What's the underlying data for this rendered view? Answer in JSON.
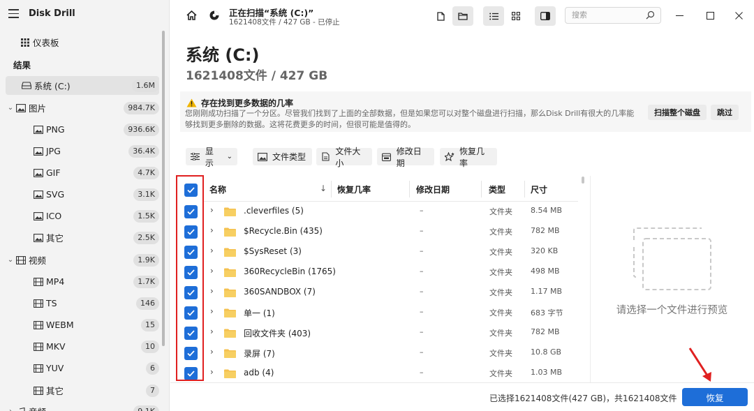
{
  "app": {
    "name": "Disk Drill"
  },
  "sidebar": {
    "dashboard": "仪表板",
    "section_results": "结果",
    "items": [
      {
        "label": "系统 (C:)",
        "count": "1.6M",
        "type": "drive"
      },
      {
        "label": "图片",
        "count": "984.7K",
        "type": "image-group"
      },
      {
        "label": "PNG",
        "count": "936.6K",
        "type": "image"
      },
      {
        "label": "JPG",
        "count": "36.4K",
        "type": "image"
      },
      {
        "label": "GIF",
        "count": "4.7K",
        "type": "image"
      },
      {
        "label": "SVG",
        "count": "3.1K",
        "type": "image"
      },
      {
        "label": "ICO",
        "count": "1.5K",
        "type": "image"
      },
      {
        "label": "其它",
        "count": "2.5K",
        "type": "image"
      },
      {
        "label": "视频",
        "count": "1.9K",
        "type": "video-group"
      },
      {
        "label": "MP4",
        "count": "1.7K",
        "type": "video"
      },
      {
        "label": "TS",
        "count": "146",
        "type": "video"
      },
      {
        "label": "WEBM",
        "count": "15",
        "type": "video"
      },
      {
        "label": "MKV",
        "count": "10",
        "type": "video"
      },
      {
        "label": "YUV",
        "count": "6",
        "type": "video"
      },
      {
        "label": "其它",
        "count": "7",
        "type": "video"
      },
      {
        "label": "音频",
        "count": "9.1K",
        "type": "audio-group"
      }
    ]
  },
  "titlebar": {
    "scan_title": "正在扫描“系统 (C:)”",
    "scan_subtitle": "1621408文件 / 427 GB - 已停止",
    "search_placeholder": "搜索"
  },
  "heading": {
    "title": "系统 (C:)",
    "subtitle": "1621408文件 / 427 GB"
  },
  "notice": {
    "title": "存在找到更多数据的几率",
    "body": "您刚刚成功扫描了一个分区。尽管我们找到了上面的全部数据，但是如果您可以对整个磁盘进行扫描，那么Disk Drill有很大的几率能够找到更多删除的数据。这将花费更多的时间，但很可能是值得的。",
    "scan_disk_label": "扫描整个磁盘",
    "skip_label": "跳过"
  },
  "filters": {
    "show": "显示",
    "file_type": "文件类型",
    "file_size": "文件大小",
    "modified_date": "修改日期",
    "recovery_chance": "恢复几率"
  },
  "table": {
    "headers": {
      "name": "名称",
      "recovery": "恢复几率",
      "modified": "修改日期",
      "type": "类型",
      "size": "尺寸"
    },
    "sort_indicator": "↓",
    "rows": [
      {
        "name": ".cleverfiles (5)",
        "recovery": "–",
        "modified": "–",
        "type": "文件夹",
        "size": "8.54 MB"
      },
      {
        "name": "$Recycle.Bin (435)",
        "recovery": "–",
        "modified": "–",
        "type": "文件夹",
        "size": "782 MB"
      },
      {
        "name": "$SysReset (3)",
        "recovery": "–",
        "modified": "–",
        "type": "文件夹",
        "size": "320 KB"
      },
      {
        "name": "360RecycleBin (1765)",
        "recovery": "–",
        "modified": "–",
        "type": "文件夹",
        "size": "498 MB"
      },
      {
        "name": "360SANDBOX (7)",
        "recovery": "–",
        "modified": "–",
        "type": "文件夹",
        "size": "1.17 MB"
      },
      {
        "name": "单一 (1)",
        "recovery": "–",
        "modified": "–",
        "type": "文件夹",
        "size": "683 字节"
      },
      {
        "name": "回收文件夹 (403)",
        "recovery": "–",
        "modified": "–",
        "type": "文件夹",
        "size": "782 MB"
      },
      {
        "name": "录屏 (7)",
        "recovery": "–",
        "modified": "–",
        "type": "文件夹",
        "size": "10.8 GB"
      },
      {
        "name": "adb (4)",
        "recovery": "–",
        "modified": "–",
        "type": "文件夹",
        "size": "1.03 MB"
      }
    ]
  },
  "preview": {
    "empty_text": "请选择一个文件进行预览"
  },
  "footer": {
    "status": "已选择1621408文件(427 GB)，共1621408文件",
    "recover_label": "恢复"
  },
  "colors": {
    "accent": "#1e6ed8",
    "annotation": "#e02020"
  }
}
